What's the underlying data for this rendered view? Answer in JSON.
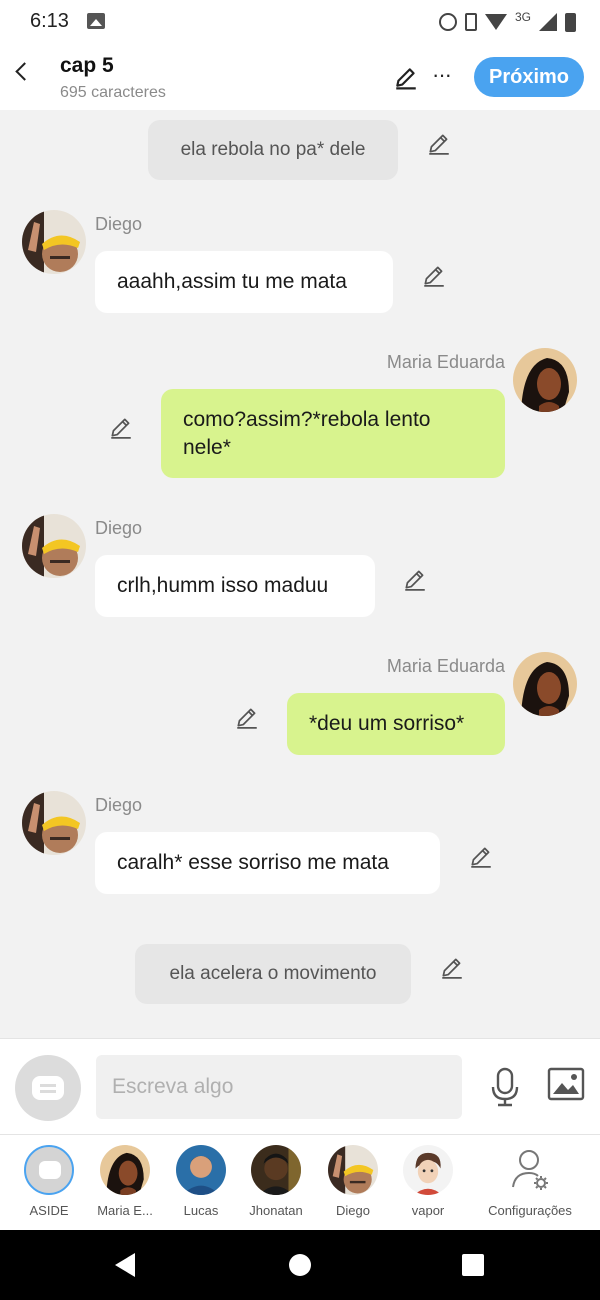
{
  "status_bar": {
    "time": "6:13",
    "network": "3G"
  },
  "header": {
    "title": "cap 5",
    "subtitle": "695 caracteres",
    "next_label": "Próximo",
    "more_label": "···"
  },
  "messages": [
    {
      "type": "narration",
      "text": "ela rebola no pa* dele"
    },
    {
      "type": "left",
      "author": "Diego",
      "text": "aaahh,assim tu me mata"
    },
    {
      "type": "right",
      "author": "Maria Eduarda",
      "text": "como?assim?*rebola lento nele*"
    },
    {
      "type": "left",
      "author": "Diego",
      "text": "crlh,humm isso maduu"
    },
    {
      "type": "right",
      "author": "Maria Eduarda",
      "text": "*deu um sorriso*"
    },
    {
      "type": "left",
      "author": "Diego",
      "text": "caralh* esse sorriso me mata"
    },
    {
      "type": "narration",
      "text": "ela acelera o movimento"
    }
  ],
  "composer": {
    "placeholder": "Escreva algo",
    "value": ""
  },
  "characters": [
    {
      "label": "ASIDE"
    },
    {
      "label": "Maria E..."
    },
    {
      "label": "Lucas"
    },
    {
      "label": "Jhonatan"
    },
    {
      "label": "Diego"
    },
    {
      "label": "vapor"
    },
    {
      "label": "Configurações"
    }
  ],
  "colors": {
    "accent": "#4aa3f0",
    "own_bubble": "#d8f38e",
    "other_bubble": "#ffffff",
    "narration_bubble": "#e6e6e6",
    "background": "#f2f2f2"
  }
}
